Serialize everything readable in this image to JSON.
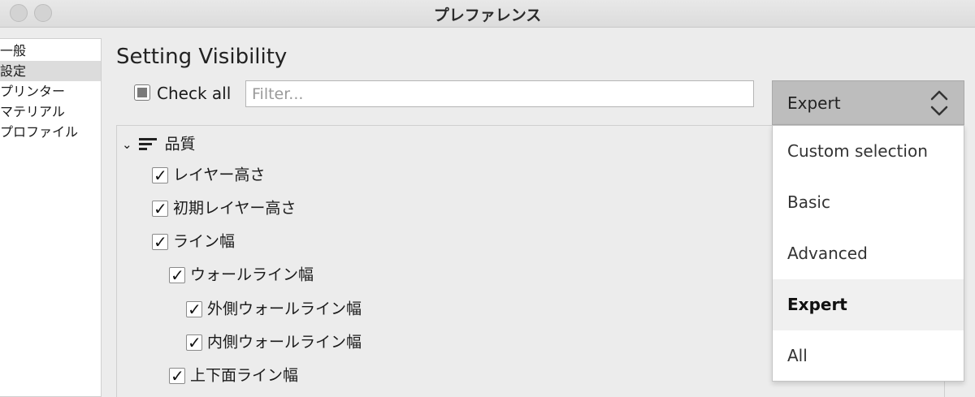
{
  "window": {
    "title": "プレファレンス"
  },
  "sidebar": {
    "items": [
      {
        "label": "一般"
      },
      {
        "label": "設定",
        "selected": true
      },
      {
        "label": "プリンター"
      },
      {
        "label": "マテリアル"
      },
      {
        "label": "プロファイル"
      }
    ]
  },
  "main": {
    "title": "Setting Visibility",
    "check_all_label": "Check all",
    "filter_placeholder": "Filter...",
    "tree": {
      "category": "品質",
      "items": [
        {
          "label": "レイヤー高さ",
          "checked": true
        },
        {
          "label": "初期レイヤー高さ",
          "checked": true
        },
        {
          "label": "ライン幅",
          "checked": true
        },
        {
          "label": "ウォールライン幅",
          "checked": true
        },
        {
          "label": "外側ウォールライン幅",
          "checked": true
        },
        {
          "label": "内側ウォールライン幅",
          "checked": true
        },
        {
          "label": "上下面ライン幅",
          "checked": true
        }
      ]
    }
  },
  "dropdown": {
    "selected": "Expert",
    "options": [
      {
        "label": "Custom selection"
      },
      {
        "label": "Basic"
      },
      {
        "label": "Advanced"
      },
      {
        "label": "Expert",
        "selected": true
      },
      {
        "label": "All"
      }
    ]
  },
  "icons": {
    "chevron": "chevron-down-icon",
    "category": "category-lines-icon",
    "updown": "updown-chevron-icon",
    "check": "✓"
  }
}
